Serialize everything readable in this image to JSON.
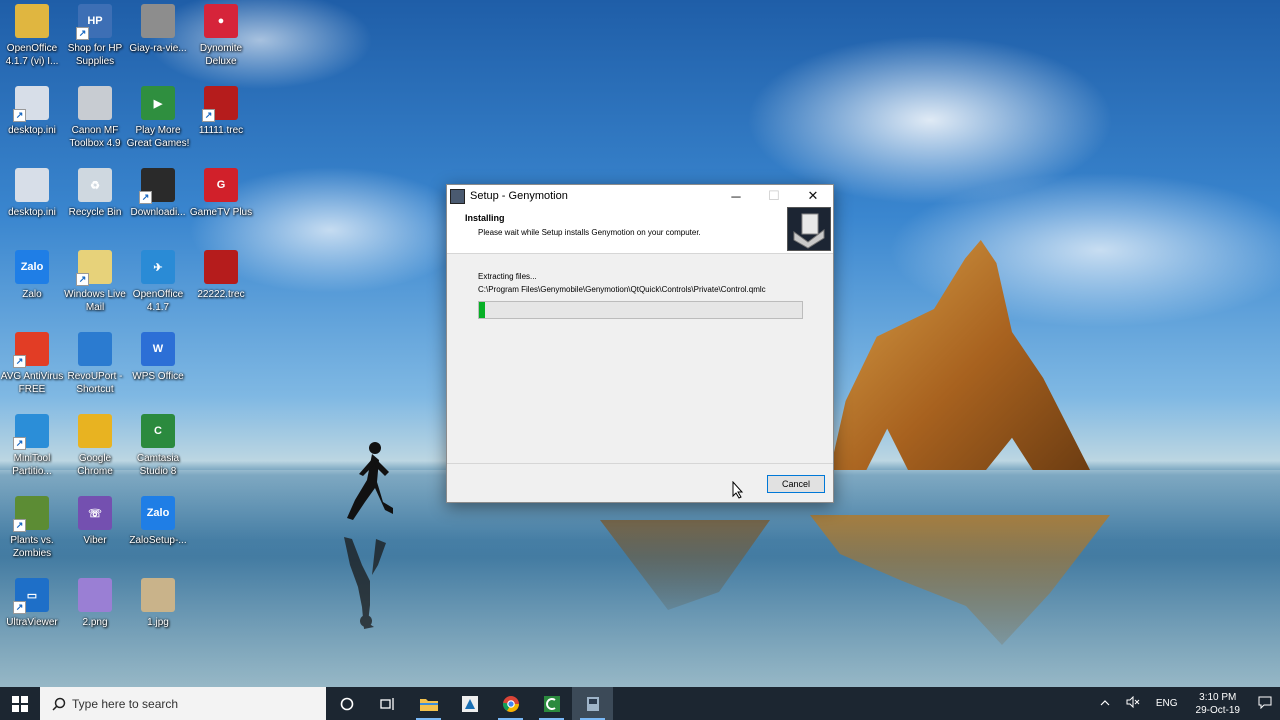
{
  "desktop": {
    "icons": [
      {
        "label": "OpenOffice\n4.1.7 (vi) I...",
        "color": "#e0b640",
        "glyph": ""
      },
      {
        "label": "Shop for HP\nSupplies",
        "color": "#3d6fb5",
        "glyph": "HP"
      },
      {
        "label": "Giay-ra-vie...",
        "color": "#8d8d8d",
        "glyph": ""
      },
      {
        "label": "Dynomite\nDeluxe",
        "color": "#d6243a",
        "glyph": "●"
      },
      {
        "label": "desktop.ini",
        "color": "#d7dee8",
        "glyph": ""
      },
      {
        "label": "Canon MF\nToolbox 4.9",
        "color": "#c8ccd2",
        "glyph": ""
      },
      {
        "label": "Play More\nGreat Games!",
        "color": "#2f8f3f",
        "glyph": "▶"
      },
      {
        "label": "11111.trec",
        "color": "#b51c1c",
        "glyph": ""
      },
      {
        "label": "desktop.ini",
        "color": "#d7dee8",
        "glyph": ""
      },
      {
        "label": "Recycle Bin",
        "color": "#cfd8e0",
        "glyph": "♻"
      },
      {
        "label": "Downloadi...",
        "color": "#2a2a2a",
        "glyph": ""
      },
      {
        "label": "GameTV Plus",
        "color": "#d1202a",
        "glyph": "G"
      },
      {
        "label": "Zalo",
        "color": "#1f7ee6",
        "glyph": "Zalo"
      },
      {
        "label": "Windows Live\nMail",
        "color": "#e7d27a",
        "glyph": ""
      },
      {
        "label": "OpenOffice\n4.1.7",
        "color": "#2a8bd6",
        "glyph": "✈"
      },
      {
        "label": "22222.trec",
        "color": "#b51c1c",
        "glyph": ""
      },
      {
        "label": "AVG AntiVirus\nFREE",
        "color": "#e23d25",
        "glyph": ""
      },
      {
        "label": "RevoUPort -\nShortcut",
        "color": "#2b7bd0",
        "glyph": ""
      },
      {
        "label": "WPS Office",
        "color": "#2c6fd6",
        "glyph": "W"
      },
      {
        "label": "MiniTool\nPartitio...",
        "color": "#2b8ed8",
        "glyph": ""
      },
      {
        "label": "Google\nChrome",
        "color": "#e8b321",
        "glyph": ""
      },
      {
        "label": "Camtasia\nStudio 8",
        "color": "#2b8a3e",
        "glyph": "C"
      },
      {
        "label": "Plants vs.\nZombies",
        "color": "#5c8c34",
        "glyph": ""
      },
      {
        "label": "Viber",
        "color": "#7450b0",
        "glyph": "☏"
      },
      {
        "label": "ZaloSetup-...",
        "color": "#1f7ee6",
        "glyph": "Zalo"
      },
      {
        "label": "UltraViewer",
        "color": "#1e6fc8",
        "glyph": "▭"
      },
      {
        "label": "2.png",
        "color": "#9a7fd4",
        "glyph": ""
      },
      {
        "label": "1.jpg",
        "color": "#c9b38a",
        "glyph": ""
      }
    ]
  },
  "dialog": {
    "title": "Setup - Genymotion",
    "header_title": "Installing",
    "header_subtitle": "Please wait while Setup installs Genymotion on your computer.",
    "status_text": "Extracting files...",
    "file_path": "C:\\Program Files\\Genymobile\\Genymotion\\QtQuick\\Controls\\Private\\Control.qmlc",
    "progress_percent": 2,
    "cancel_label": "Cancel",
    "minimize_glyph": "─",
    "maximize_glyph": "☐",
    "close_glyph": "✕"
  },
  "taskbar": {
    "search_placeholder": "Type here to search",
    "language": "ENG",
    "time": "3:10 PM",
    "date": "29-Oct-19"
  }
}
